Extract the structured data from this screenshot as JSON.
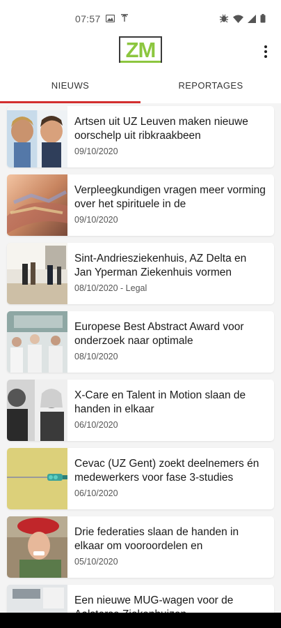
{
  "status_bar": {
    "time": "07:57",
    "left_icons": [
      "image-icon",
      "antenna-icon"
    ],
    "right_icons": [
      "bug-icon",
      "wifi-icon",
      "signal-icon",
      "battery-icon"
    ]
  },
  "app_bar": {
    "logo_text": "ZM",
    "menu_icon": "more-vert-icon",
    "logo_color": "#8cc63f"
  },
  "tabs": [
    {
      "label": "NIEUWS",
      "active": true
    },
    {
      "label": "REPORTAGES",
      "active": false
    }
  ],
  "accent_color": "#d32f2f",
  "articles": [
    {
      "title": "Artsen uit UZ Leuven maken nieuwe oorschelp uit ribkraakbeen",
      "meta": "09/10/2020"
    },
    {
      "title": "Verpleegkundigen vragen meer vorming over het spirituele in de",
      "meta": "09/10/2020"
    },
    {
      "title": "Sint-Andriesziekenhuis, AZ Delta en Jan Yperman Ziekenhuis vormen",
      "meta": "08/10/2020 - Legal"
    },
    {
      "title": "Europese Best Abstract Award voor onderzoek naar optimale",
      "meta": "08/10/2020"
    },
    {
      "title": "X-Care en Talent in Motion slaan de handen in elkaar",
      "meta": "06/10/2020"
    },
    {
      "title": "Cevac (UZ Gent) zoekt deelnemers én medewerkers voor fase 3-studies",
      "meta": "06/10/2020"
    },
    {
      "title": "Drie federaties slaan de handen in elkaar om vooroordelen en",
      "meta": "05/10/2020"
    },
    {
      "title": "Een nieuwe MUG-wagen voor de Aalsterse Ziekenhuizen",
      "meta": ""
    }
  ]
}
